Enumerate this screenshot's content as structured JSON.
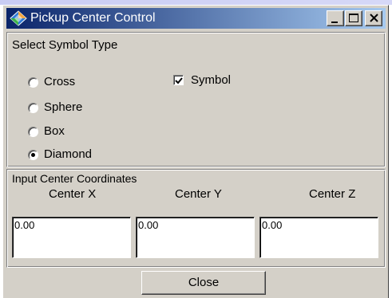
{
  "window": {
    "title": "Pickup Center Control",
    "icon": "app-diamond-icon"
  },
  "caption_buttons": {
    "minimize": "minimize-icon",
    "maximize": "maximize-icon",
    "close": "close-icon"
  },
  "symbol_type": {
    "group_label": "Select Symbol Type",
    "options": [
      {
        "label": "Cross",
        "selected": false
      },
      {
        "label": "Sphere",
        "selected": false
      },
      {
        "label": "Box",
        "selected": false
      },
      {
        "label": "Diamond",
        "selected": true
      }
    ],
    "symbol_checkbox": {
      "label": "Symbol",
      "checked": true
    }
  },
  "center_coordinates": {
    "group_label": "Input Center Coordinates",
    "fields": [
      {
        "label": "Center X",
        "value": "0.00"
      },
      {
        "label": "Center Y",
        "value": "0.00"
      },
      {
        "label": "Center Z",
        "value": "0.00"
      }
    ]
  },
  "footer": {
    "close_label": "Close"
  }
}
